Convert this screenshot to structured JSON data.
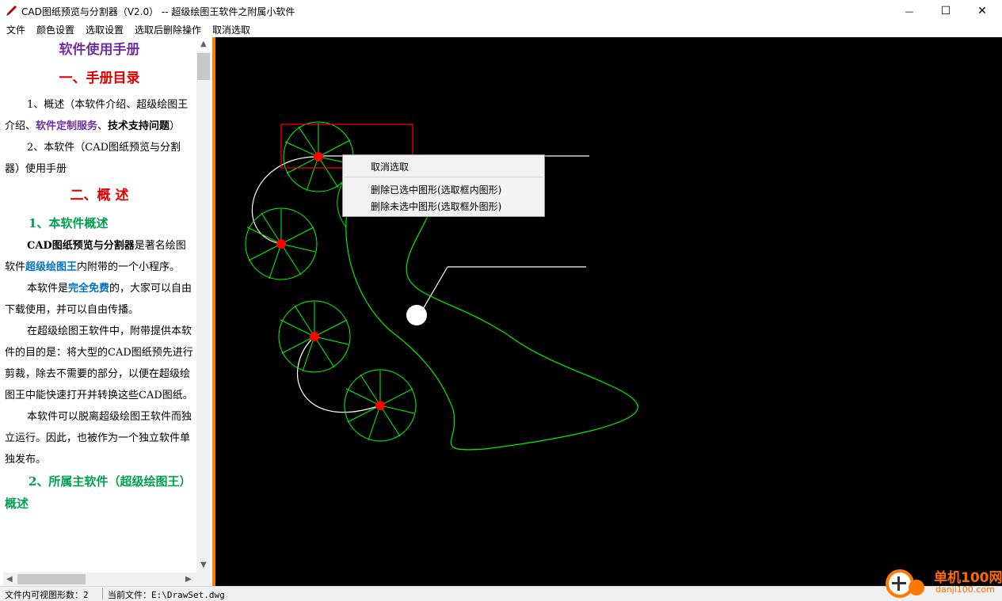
{
  "window": {
    "title": "CAD图纸预览与分割器（V2.0） -- 超级绘图王软件之附属小软件",
    "minimize_glyph": "—",
    "maximize_glyph": "☐",
    "close_glyph": "✕"
  },
  "menu": [
    {
      "label": "文件"
    },
    {
      "label": "颜色设置"
    },
    {
      "label": "选取设置"
    },
    {
      "label": "选取后删除操作"
    },
    {
      "label": "取消选取"
    }
  ],
  "doc": {
    "title": "软件使用手册",
    "section1": "一、手册目录",
    "toc1_a": "1、概述（本软件介绍、超级绘图王介绍、",
    "toc1_b": "软件定制服务",
    "toc1_c": "、",
    "toc1_d": "技术支持问题",
    "toc1_e": "）",
    "toc2": "2、本软件（CAD图纸预览与分割器）使用手册",
    "section2": "二、概  述",
    "sub1": "1、本软件概述",
    "p1_a": "CAD图纸预览与分割器",
    "p1_b": "是著名绘图软件",
    "p1_c": "超级绘图王",
    "p1_d": "内附带的一个小程序。",
    "p2_a": "本软件是",
    "p2_b": "完全免费",
    "p2_c": "的，大家可以自由下载使用，并可以自由传播。",
    "p3": "在超级绘图王软件中，附带提供本软件的目的是：将大型的CAD图纸预先进行剪裁，除去不需要的部分，以便在超级绘图王中能快速打开并转换这些CAD图纸。",
    "p4": "本软件可以脱离超级绘图王软件而独立运行。因此，也被作为一个独立软件单独发布。",
    "sub2": "2、所属主软件（超级绘图王）概述"
  },
  "context_menu": {
    "items": [
      {
        "label": "取消选取"
      },
      {
        "label": "删除已选中图形(选取框内图形)"
      },
      {
        "label": "删除未选中图形(选取框外图形)"
      }
    ]
  },
  "statusbar": {
    "shape_count": "文件内可视图形数：2",
    "current_file": "当前文件：E:\\DrawSet.dwg"
  },
  "watermark": {
    "brand": "单机100网",
    "url": "danji100.com"
  },
  "colors": {
    "accent_splitter": "#ff8000",
    "canvas_bg": "#000000",
    "cad_green": "#00ff00",
    "cad_red": "#ff0000",
    "selection_box": "#ff0000"
  }
}
